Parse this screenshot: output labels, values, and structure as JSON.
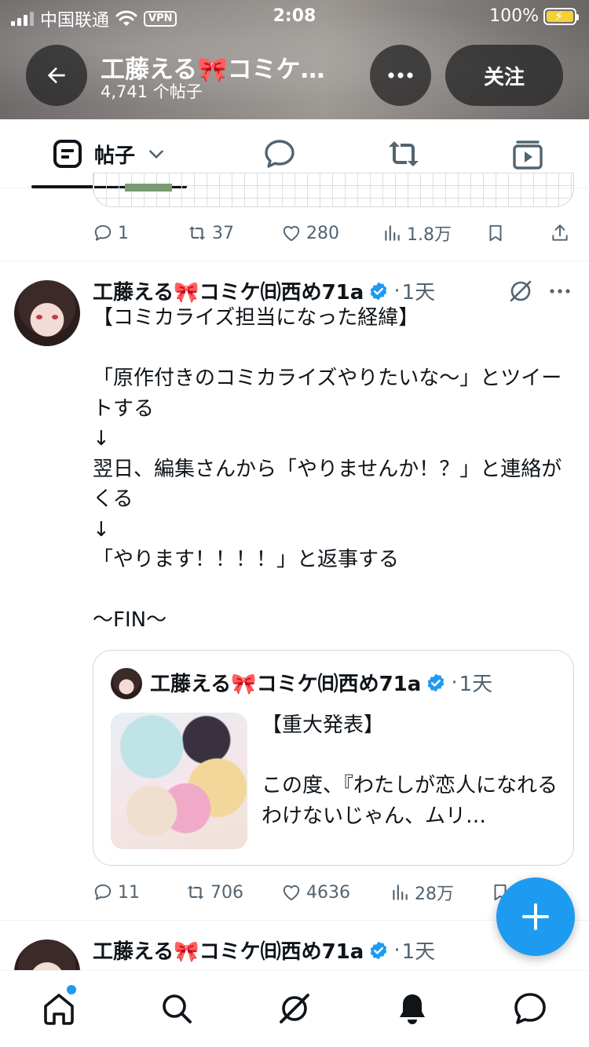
{
  "status_bar": {
    "carrier": "中国联通",
    "vpn": "VPN",
    "time": "2:08",
    "battery": "100%"
  },
  "header": {
    "title": "工藤える🎀コミケ…",
    "post_count": "4,741 个帖子",
    "follow_label": "关注"
  },
  "tabs": {
    "posts_label": "帖子"
  },
  "prev_post": {
    "replies": "1",
    "reposts": "37",
    "likes": "280",
    "views": "1.8万"
  },
  "post": {
    "author": "工藤える🎀コミケ㈰西め71a",
    "time": "1天",
    "text": "【コミカライズ担当になった経緯】\n\n「原作付きのコミカライズやりたいな〜」とツイートする\n↓\n翌日、編集さんから「やりませんか！？」と連絡がくる\n↓\n「やります！！！！」と返事する\n\n〜FIN〜",
    "replies": "11",
    "reposts": "706",
    "likes": "4636",
    "views": "28万"
  },
  "quote": {
    "author": "工藤える🎀コミケ㈰西め71a",
    "time": "1天",
    "text": "【重大発表】\n\nこの度、『わたしが恋人になれるわけないじゃん、ムリ…"
  },
  "next_post": {
    "author": "工藤える🎀コミケ㈰西め71a",
    "time": "1天"
  },
  "colors": {
    "accent": "#1d9bf0",
    "text": "#0f1419",
    "muted": "#536471"
  }
}
